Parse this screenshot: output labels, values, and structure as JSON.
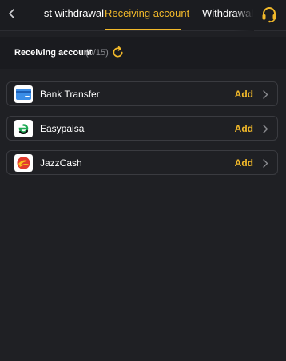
{
  "header": {
    "tabs": [
      {
        "label": "st withdrawal",
        "active": false
      },
      {
        "label": "Receiving account",
        "active": true
      },
      {
        "label": "Withdrawal r",
        "active": false
      }
    ],
    "accent_color": "#f2b92a"
  },
  "section": {
    "title": "Receiving account",
    "count": "(0/15)"
  },
  "accounts": [
    {
      "label": "Bank Transfer",
      "action": "Add",
      "icon": "bank-card-icon"
    },
    {
      "label": "Easypaisa",
      "action": "Add",
      "icon": "easypaisa-logo-icon"
    },
    {
      "label": "JazzCash",
      "action": "Add",
      "icon": "jazzcash-logo-icon"
    }
  ]
}
